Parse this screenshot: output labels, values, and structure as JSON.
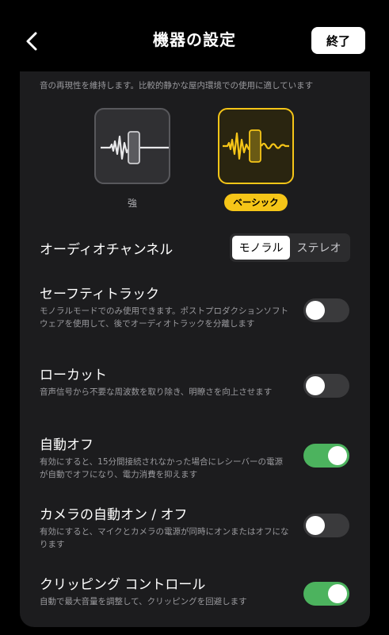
{
  "header": {
    "title": "機器の設定",
    "back_icon": "chevron-left-icon",
    "done_label": "終了"
  },
  "mode": {
    "description": "音の再現性を維持します。比較的静かな屋内環境での使用に適しています",
    "options": [
      {
        "label": "強",
        "selected": false
      },
      {
        "label": "ベーシック",
        "selected": true
      }
    ],
    "accent_color": "#f5c518"
  },
  "audio_channel": {
    "title": "オーディオチャンネル",
    "options": [
      "モノラル",
      "ステレオ"
    ],
    "selected": "モノラル"
  },
  "settings": [
    {
      "title": "セーフティトラック",
      "description": "モノラルモードでのみ使用できます。ポストプロダクションソフトウェアを使用して、後でオーディオトラックを分離します",
      "enabled": false
    },
    {
      "title": "ローカット",
      "description": "音声信号から不要な周波数を取り除き、明瞭さを向上させます",
      "enabled": false
    },
    {
      "title": "自動オフ",
      "description": "有効にすると、15分間接続されなかった場合にレシーバーの電源が自動でオフになり、電力消費を抑えます",
      "enabled": true
    },
    {
      "title": "カメラの自動オン / オフ",
      "description": "有効にすると、マイクとカメラの電源が同時にオンまたはオフになります",
      "enabled": false
    },
    {
      "title": "クリッピング コントロール",
      "description": "自動で最大音量を調整して、クリッピングを回避します",
      "enabled": true
    }
  ],
  "colors": {
    "toggle_on": "#4cb35e",
    "toggle_off": "#3a3a3c",
    "card_bg": "#1c1c1e"
  }
}
